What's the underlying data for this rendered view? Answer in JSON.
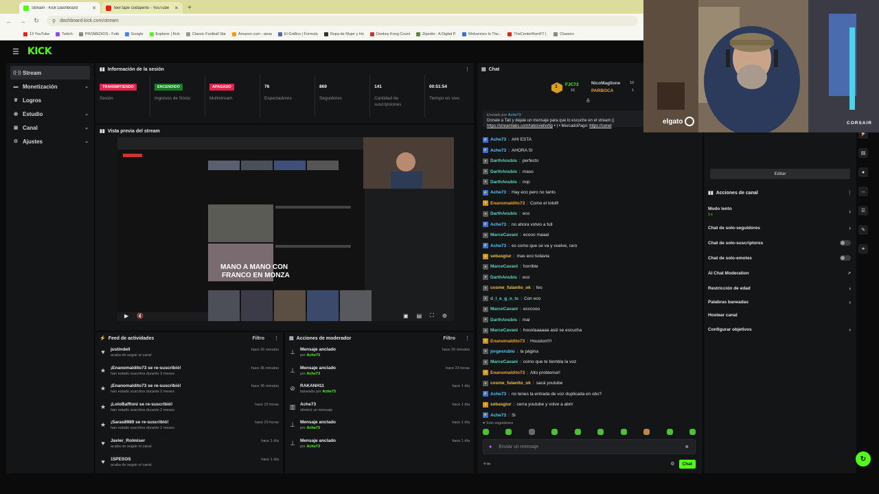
{
  "browser": {
    "tabs": [
      {
        "title": "Stream - Kick Dashboard",
        "active": true,
        "color": "#53fc18"
      },
      {
        "title": "feel tape codaperto - YouTube",
        "active": false,
        "color": "#e62117"
      }
    ],
    "url": "dashboard.kick.com/stream",
    "bookmarks": [
      "13 YouTube",
      "Twitch",
      "PROMEDIOS - Futb...",
      "Google",
      "Explorer | Kick",
      "Classic Football Stat...",
      "Amazon.com - amaz...",
      "El Gráfico | Formula 1",
      "Ropa de Mujer y Ho...",
      "Donkey Kong Count...",
      "Zipertto - A Digital P...",
      "Wolverines Is The...",
      "TheCenterRomFT |...",
      "Chasers"
    ]
  },
  "header": {
    "logo": "KICK"
  },
  "sidebar": {
    "items": [
      {
        "label": "Stream",
        "icon": "broadcast-icon",
        "glyph": "((·))",
        "active": true,
        "chevron": false
      },
      {
        "label": "Monetización",
        "icon": "money-icon",
        "glyph": "▬",
        "active": false,
        "chevron": true
      },
      {
        "label": "Logros",
        "icon": "trophy-icon",
        "glyph": "♛",
        "active": false,
        "chevron": false
      },
      {
        "label": "Estudio",
        "icon": "studio-icon",
        "glyph": "◉",
        "active": false,
        "chevron": true
      },
      {
        "label": "Canal",
        "icon": "channel-icon",
        "glyph": "▣",
        "active": false,
        "chevron": true
      },
      {
        "label": "Ajustes",
        "icon": "settings-icon",
        "glyph": "⚙",
        "active": false,
        "chevron": true
      }
    ]
  },
  "session": {
    "title": "Información de la sesión",
    "stats": [
      {
        "value": "TRANSMITIENDO",
        "label": "Sesión",
        "badge": true,
        "bg": "#e0264b",
        "fg": "#ffffff",
        "width": 80
      },
      {
        "value": "ENCENDIDO",
        "label": "Ingresos de Socio",
        "badge": true,
        "bg": "#1e7b28",
        "fg": "#e6ffe6",
        "width": 80
      },
      {
        "value": "APAGADO",
        "label": "Multistream",
        "badge": true,
        "bg": "#e0264b",
        "fg": "#ffffff",
        "width": 80
      },
      {
        "value": "76",
        "label": "Espectadores",
        "badge": false,
        "width": 80
      },
      {
        "value": "869",
        "label": "Seguidores",
        "badge": false,
        "width": 80
      },
      {
        "value": "141",
        "label": "Cantidad de suscripciones",
        "badge": false,
        "width": 80
      },
      {
        "value": "00:51:54",
        "label": "Tiempo en vivo",
        "badge": false,
        "width": 71
      }
    ]
  },
  "preview": {
    "title": "Vista previa del stream"
  },
  "feed": {
    "title": "Feed de actividades",
    "filter": "Filtro",
    "items": [
      {
        "icon": "heart-icon",
        "glyph": "♥",
        "title": "justindell",
        "sub": "acaba de seguir el canal",
        "time": "hace 20 minutos"
      },
      {
        "icon": "star-icon",
        "glyph": "★",
        "title": "¡Enanomaldito73 se re-suscribió!",
        "sub": "han estado suscritos durante 3 meses",
        "time": "hace 36 minutos"
      },
      {
        "icon": "star-icon",
        "glyph": "★",
        "title": "¡Enanomaldito73 se re-suscribió!",
        "sub": "han estado suscritos durante 2 meses",
        "time": "hace 36 minutos"
      },
      {
        "icon": "star-icon",
        "glyph": "★",
        "title": "¡LoloBaffioni se re-suscribió!",
        "sub": "han estado suscritos durante 2 meses",
        "time": "hace 23 horas"
      },
      {
        "icon": "star-icon",
        "glyph": "★",
        "title": "¡Saras8989 se re-suscribió!",
        "sub": "han estado suscritos durante 2 meses",
        "time": "hace 23 horas"
      },
      {
        "icon": "heart-icon",
        "glyph": "♥",
        "title": "Javier_Rolmiser",
        "sub": "acaba de seguir el canal",
        "time": "hace 1 día"
      },
      {
        "icon": "heart-icon",
        "glyph": "♥",
        "title": "15PESOS",
        "sub": "acaba de seguir el canal",
        "time": "hace 1 día"
      }
    ]
  },
  "modactions": {
    "title": "Acciones de moderador",
    "filter": "Filtro",
    "items": [
      {
        "icon": "pin-icon",
        "glyph": "⊥",
        "title": "Mensaje anclado",
        "sub_prefix": "por",
        "sub_user": "Ache73",
        "time": "hace 20 minutos"
      },
      {
        "icon": "pin-icon",
        "glyph": "⊥",
        "title": "Mensaje anclado",
        "sub_prefix": "por",
        "sub_user": "Ache73",
        "time": "hace 23 horas"
      },
      {
        "icon": "ban-icon",
        "glyph": "⊘",
        "title": "RAKANH11",
        "sub_prefix": "baneado por",
        "sub_user": "Ache73",
        "time": "hace 1 día"
      },
      {
        "icon": "trash-icon",
        "glyph": "▥",
        "title": "Ache73",
        "sub_prefix": "eliminó un mensaje",
        "sub_user": "",
        "time": "hace 1 día"
      },
      {
        "icon": "pin-icon",
        "glyph": "⊥",
        "title": "Mensaje anclado",
        "sub_prefix": "por",
        "sub_user": "Ache73",
        "time": "hace 1 día"
      },
      {
        "icon": "pin-icon",
        "glyph": "⊥",
        "title": "Mensaje anclado",
        "sub_prefix": "por",
        "sub_user": "Ache73",
        "time": "hace 1 día"
      }
    ]
  },
  "chat": {
    "title": "Chat",
    "top": {
      "badge_value": "1",
      "users": [
        {
          "name": "FJC73",
          "count": "16",
          "color": "#53fc18"
        },
        {
          "name": "NicoMaglione",
          "count": "10",
          "color": "#d0d0d0"
        },
        {
          "name": "PARBOCA",
          "count": "1",
          "color": "#f0a030"
        }
      ]
    },
    "pinned": {
      "label": "Enviado por",
      "user": "Ache73",
      "text": "Donale a Tati y dejale un mensaje para que lo escuche en el stream ||",
      "link": "https://streamlabs.com/taticiviello/tip",
      "extra": "• | • MercadoPago:",
      "link2": "https://cenel"
    },
    "messages": [
      {
        "user": "Ache73",
        "text": "AHI ESTA",
        "color": "#53c8ff",
        "badge_color": "#3a6fd8",
        "badge": "⚡"
      },
      {
        "user": "Ache73",
        "text": "AHORA SI",
        "color": "#53c8ff",
        "badge_color": "#3a6fd8",
        "badge": "⚡"
      },
      {
        "user": "DarthAnubis",
        "text": "perfecto",
        "color": "#5fd4c0",
        "badge_color": "#5a5a5a",
        "badge": "♦"
      },
      {
        "user": "DarthAnubis",
        "text": "maso",
        "color": "#5fd4c0",
        "badge_color": "#5a5a5a",
        "badge": "♦"
      },
      {
        "user": "DarthAnubis",
        "text": "nop",
        "color": "#5fd4c0",
        "badge_color": "#5a5a5a",
        "badge": "♦"
      },
      {
        "user": "Ache73",
        "text": "Hay eco pero no tanto",
        "color": "#53c8ff",
        "badge_color": "#3a6fd8",
        "badge": "⚡"
      },
      {
        "user": "Enanomaldito73",
        "text": "Como el totoll!",
        "color": "#f5a623",
        "badge_color": "#c8941f",
        "badge": "♛"
      },
      {
        "user": "DarthAnubis",
        "text": "eco",
        "color": "#5fd4c0",
        "badge_color": "#5a5a5a",
        "badge": "♦"
      },
      {
        "user": "Ache73",
        "text": "no ahora volvio a full",
        "color": "#53c8ff",
        "badge_color": "#3a6fd8",
        "badge": "⚡"
      },
      {
        "user": "MarceCavani",
        "text": "ecooo maaal",
        "color": "#5fd4c0",
        "badge_color": "#5a5a5a",
        "badge": "♦"
      },
      {
        "user": "Ache73",
        "text": "es como que se va y vuelve, raro",
        "color": "#53c8ff",
        "badge_color": "#3a6fd8",
        "badge": "⚡"
      },
      {
        "user": "sebasgiur",
        "text": "mas eco todavia",
        "color": "#f0c040",
        "badge_color": "#c8941f",
        "badge": "♛"
      },
      {
        "user": "MarceCavani",
        "text": "horrible",
        "color": "#5fd4c0",
        "badge_color": "#5a5a5a",
        "badge": "♦"
      },
      {
        "user": "DarthAnubis",
        "text": "eco",
        "color": "#5fd4c0",
        "badge_color": "#5a5a5a",
        "badge": "♦"
      },
      {
        "user": "cosme_fulanito_ok",
        "text": "feo",
        "color": "#f0c040",
        "badge_color": "#5a5a5a",
        "badge": "♦"
      },
      {
        "user": "d_l_e_g_o_tc",
        "text": "Con eco",
        "color": "#5fd4c0",
        "badge_color": "#5a5a5a",
        "badge": "♦"
      },
      {
        "user": "MarceCavani",
        "text": "ecccooo",
        "color": "#5fd4c0",
        "badge_color": "#5a5a5a",
        "badge": "♦"
      },
      {
        "user": "DarthAnubis",
        "text": "mal",
        "color": "#5fd4c0",
        "badge_color": "#5a5a5a",
        "badge": "♦"
      },
      {
        "user": "MarceCavani",
        "text": "hooolaaaaaa asiii se escucha",
        "color": "#5fd4c0",
        "badge_color": "#5a5a5a",
        "badge": "♦"
      },
      {
        "user": "Enanomaldito73",
        "text": "Houston!!!!",
        "color": "#f5a623",
        "badge_color": "#c8941f",
        "badge": "♛"
      },
      {
        "user": "jorgesrubio",
        "text": "la página",
        "color": "#53c8ff",
        "badge_color": "#5a5a5a",
        "badge": "♦"
      },
      {
        "user": "MarceCavani",
        "text": "como que te tiembla la voz",
        "color": "#5fd4c0",
        "badge_color": "#5a5a5a",
        "badge": "♦"
      },
      {
        "user": "Enanomaldito73",
        "text": "Alto problema!!",
        "color": "#f5a623",
        "badge_color": "#c8941f",
        "badge": "♛"
      },
      {
        "user": "cosme_fulanito_ok",
        "text": "sacá youtube",
        "color": "#f0c040",
        "badge_color": "#5a5a5a",
        "badge": "♦"
      },
      {
        "user": "Ache73",
        "text": "no tenes la entrada de voz duplicada en obs?",
        "color": "#53c8ff",
        "badge_color": "#3a6fd8",
        "badge": "⚡"
      },
      {
        "user": "sebasgiur",
        "text": "cerra youtube y volve a abrir",
        "color": "#f0c040",
        "badge_color": "#c8941f",
        "badge": "♛"
      },
      {
        "user": "Ache73",
        "text": "Si",
        "color": "#53c8ff",
        "badge_color": "#3a6fd8",
        "badge": "⚡"
      }
    ],
    "solo_label": "Solo seguidores",
    "input_placeholder": "Enviar un mensaje",
    "send_label": "Chat"
  },
  "channel": {
    "edit_label": "Editar",
    "title": "Acciones de canal",
    "rows": [
      {
        "label": "Modo lento",
        "sub": "1 s",
        "control": "chevron",
        "h": 25
      },
      {
        "label": "Chat de solo-seguidores",
        "sub": "",
        "control": "chevron",
        "h": 22
      },
      {
        "label": "Chat de solo-suscriptores",
        "sub": "",
        "control": "toggle",
        "h": 22
      },
      {
        "label": "Chat de solo-emotes",
        "sub": "",
        "control": "toggle",
        "h": 22
      },
      {
        "label": "AI Chat Moderation",
        "sub": "",
        "control": "link",
        "h": 22
      },
      {
        "label": "Restricción de edad",
        "sub": "",
        "control": "chevron",
        "h": 22
      },
      {
        "label": "Palabras baneadas",
        "sub": "",
        "control": "chevron",
        "h": 19
      },
      {
        "label": "Hostear canal",
        "sub": "",
        "control": "none",
        "h": 19
      },
      {
        "label": "Configurar objetivos",
        "sub": "",
        "control": "chevron",
        "h": 22
      }
    ]
  },
  "webcam": {
    "brand1": "elgato",
    "brand2": "CORSAIR"
  }
}
